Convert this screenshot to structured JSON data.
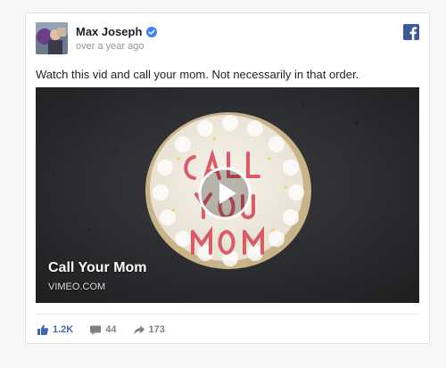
{
  "post": {
    "author": "Max Joseph",
    "timestamp": "over a year ago",
    "text": "Watch this vid and call your mom. Not necessarily in that order.",
    "verified": true
  },
  "video": {
    "title": "Call Your Mom",
    "source": "VIMEO.COM",
    "cake_writing": "CALL YOUR MOM"
  },
  "stats": {
    "likes": "1.2K",
    "comments": "44",
    "shares": "173"
  },
  "colors": {
    "facebook_blue": "#3b5998",
    "like_blue": "#4267b2",
    "verified_blue": "#4080ff",
    "icon_gray": "#7f7f7f"
  },
  "icons": [
    "avatar",
    "verified-badge-icon",
    "facebook-logo-icon",
    "play-icon",
    "like-icon",
    "comment-icon",
    "share-icon"
  ]
}
